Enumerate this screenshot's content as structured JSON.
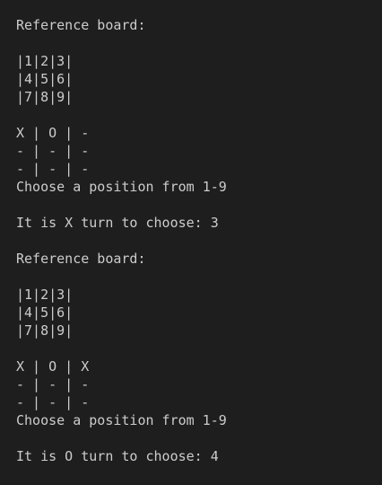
{
  "terminal": {
    "lines": [
      "Reference board:",
      "",
      "|1|2|3|",
      "|4|5|6|",
      "|7|8|9|",
      "",
      "X | O | -",
      "- | - | -",
      "- | - | -",
      "Choose a position from 1-9",
      "",
      "It is X turn to choose: 3",
      "",
      "Reference board:",
      "",
      "|1|2|3|",
      "|4|5|6|",
      "|7|8|9|",
      "",
      "X | O | X",
      "- | - | -",
      "- | - | -",
      "Choose a position from 1-9",
      "",
      "It is O turn to choose: 4"
    ]
  },
  "colors": {
    "background": "#1e1e1e",
    "text": "#cccccc"
  }
}
